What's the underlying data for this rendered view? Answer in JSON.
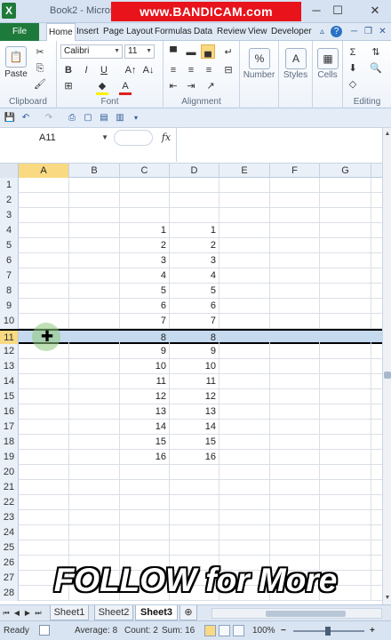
{
  "window": {
    "title": "Book2 - Micros",
    "watermark": "www.BANDICAM.com",
    "app_icon": "X",
    "minimize": "─",
    "maximize": "☐",
    "close": "✕"
  },
  "ribbon_tabs": {
    "file": "File",
    "items": [
      "Home",
      "Insert",
      "Page Layout",
      "Formulas",
      "Data",
      "Review",
      "View",
      "Developer"
    ]
  },
  "ribbon": {
    "clipboard": {
      "label": "Clipboard",
      "paste": "Paste"
    },
    "font": {
      "label": "Font",
      "name": "Calibri",
      "size": "11",
      "bold": "B",
      "italic": "I",
      "underline": "U",
      "font_color": "A"
    },
    "alignment": {
      "label": "Alignment"
    },
    "number": {
      "label": "Number",
      "icon": "%"
    },
    "styles": {
      "label": "Styles"
    },
    "cells": {
      "label": "Cells"
    },
    "editing": {
      "label": "Editing",
      "sum": "Σ"
    }
  },
  "formula_bar": {
    "name_box": "A11",
    "fx": "fx",
    "value": ""
  },
  "columns": [
    "A",
    "B",
    "C",
    "D",
    "E",
    "F",
    "G"
  ],
  "selected_column": "A",
  "rows": [
    {
      "n": "1",
      "c": "",
      "d": ""
    },
    {
      "n": "2",
      "c": "",
      "d": ""
    },
    {
      "n": "3",
      "c": "",
      "d": ""
    },
    {
      "n": "4",
      "c": "1",
      "d": "1"
    },
    {
      "n": "5",
      "c": "2",
      "d": "2"
    },
    {
      "n": "6",
      "c": "3",
      "d": "3"
    },
    {
      "n": "7",
      "c": "4",
      "d": "4"
    },
    {
      "n": "8",
      "c": "5",
      "d": "5"
    },
    {
      "n": "9",
      "c": "6",
      "d": "6"
    },
    {
      "n": "10",
      "c": "7",
      "d": "7"
    },
    {
      "n": "11",
      "c": "8",
      "d": "8"
    },
    {
      "n": "12",
      "c": "9",
      "d": "9"
    },
    {
      "n": "13",
      "c": "10",
      "d": "10"
    },
    {
      "n": "14",
      "c": "11",
      "d": "11"
    },
    {
      "n": "15",
      "c": "12",
      "d": "12"
    },
    {
      "n": "16",
      "c": "13",
      "d": "13"
    },
    {
      "n": "17",
      "c": "14",
      "d": "14"
    },
    {
      "n": "18",
      "c": "15",
      "d": "15"
    },
    {
      "n": "19",
      "c": "16",
      "d": "16"
    },
    {
      "n": "20",
      "c": "",
      "d": ""
    },
    {
      "n": "21",
      "c": "",
      "d": ""
    },
    {
      "n": "22",
      "c": "",
      "d": ""
    },
    {
      "n": "23",
      "c": "",
      "d": ""
    },
    {
      "n": "24",
      "c": "",
      "d": ""
    },
    {
      "n": "25",
      "c": "",
      "d": ""
    },
    {
      "n": "26",
      "c": "",
      "d": ""
    },
    {
      "n": "27",
      "c": "",
      "d": ""
    },
    {
      "n": "28",
      "c": "",
      "d": ""
    }
  ],
  "selected_row": "11",
  "overlay_text": "FOLLOW for More",
  "sheets": [
    "Sheet1",
    "Sheet2",
    "Sheet3"
  ],
  "active_sheet": "Sheet3",
  "status": {
    "mode": "Ready",
    "average": "Average: 8",
    "count": "Count: 2",
    "sum": "Sum: 16",
    "zoom": "100%"
  },
  "colors": {
    "file_tab": "#1d7a3b",
    "selection_fill": "#c5d9ef",
    "header_highlight": "#f9d981",
    "watermark_bg": "#e8131b"
  }
}
